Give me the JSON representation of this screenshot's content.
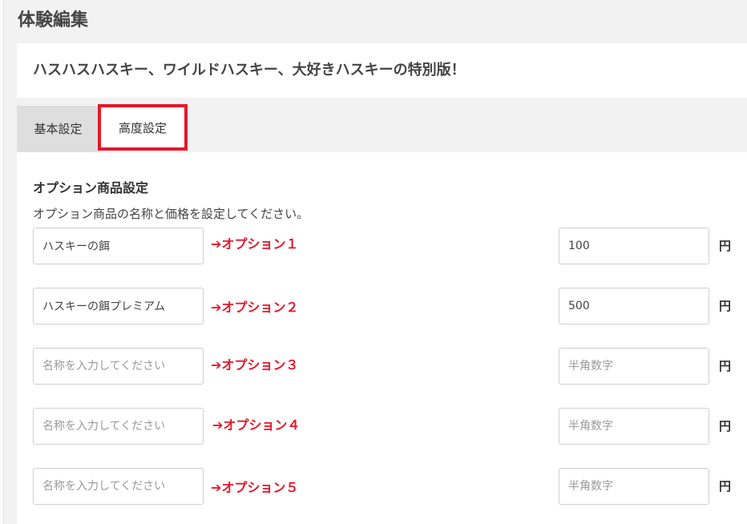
{
  "header": {
    "title": "体験編集"
  },
  "experience": {
    "title": "ハスハスハスキー、ワイルドハスキー、大好きハスキーの特別版！"
  },
  "tabs": [
    {
      "label": "基本設定",
      "active": false
    },
    {
      "label": "高度設定",
      "active": true
    }
  ],
  "options_section": {
    "title": "オプション商品設定",
    "description": "オプション商品の名称と価格を設定してください。",
    "unit": "円",
    "rows": [
      {
        "name": "ハスキーの餌",
        "name_placeholder": "名称を入力してください",
        "price": "100",
        "price_placeholder": "半角数字",
        "annotation": "➔オプション１"
      },
      {
        "name": "ハスキーの餌プレミアム",
        "name_placeholder": "名称を入力してください",
        "price": "500",
        "price_placeholder": "半角数字",
        "annotation": "➔オプション２"
      },
      {
        "name": "",
        "name_placeholder": "名称を入力してください",
        "price": "",
        "price_placeholder": "半角数字",
        "annotation": "➔オプション３"
      },
      {
        "name": "",
        "name_placeholder": "名称を入力してください",
        "price": "",
        "price_placeholder": "半角数字",
        "annotation": "➔オプション４"
      },
      {
        "name": "",
        "name_placeholder": "名称を入力してください",
        "price": "",
        "price_placeholder": "半角数字",
        "annotation": "➔オプション５"
      }
    ]
  },
  "colors": {
    "highlight": "#e5182a",
    "annotation": "#e5182a",
    "tab_inactive": "#dedede",
    "background": "#f2f2f2"
  }
}
